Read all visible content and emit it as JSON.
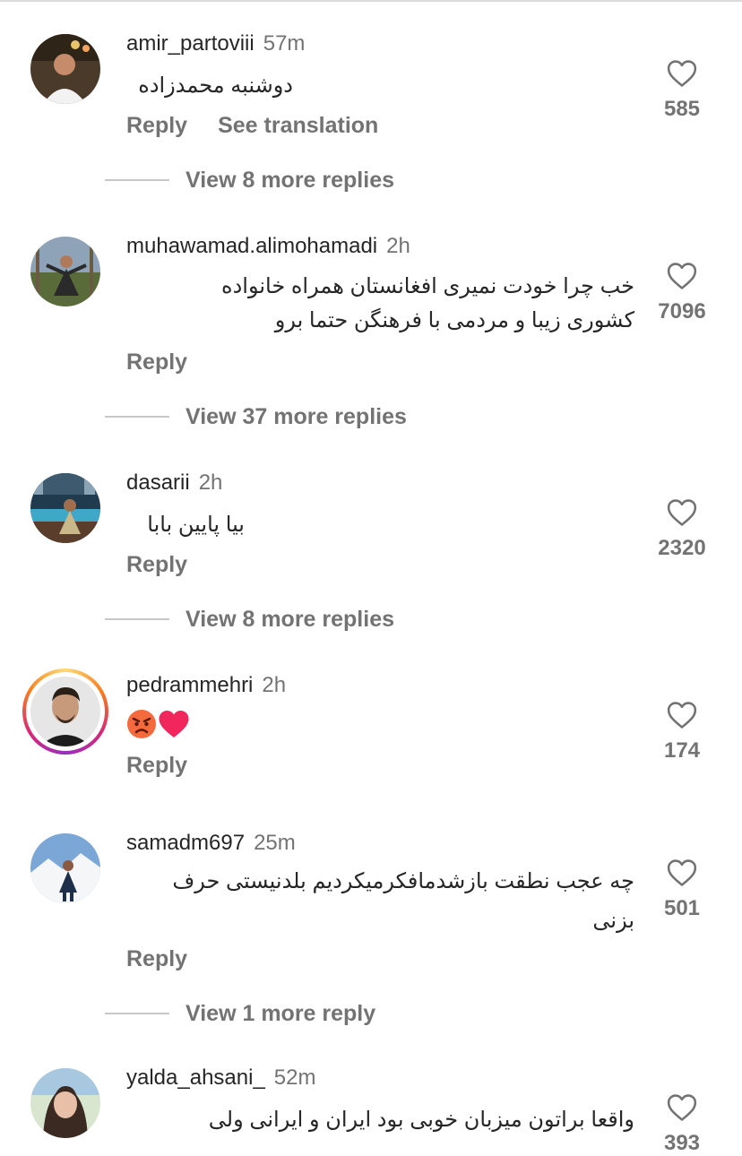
{
  "comments": [
    {
      "username": "amir_partoviii",
      "time": "57m",
      "text": "دوشنبه محمدزاده",
      "actions": [
        "Reply",
        "See translation"
      ],
      "likes": "585",
      "view_more": "View 8 more replies"
    },
    {
      "username": "muhawamad.alimohamadi",
      "time": "2h",
      "text_lines": [
        "خب چرا خودت نمیری افغانستان همراه خانواده",
        "کشوری زیبا و مردمی با فرهنگن حتما برو"
      ],
      "actions": [
        "Reply"
      ],
      "likes": "7096",
      "view_more": "View 37 more replies"
    },
    {
      "username": "dasarii",
      "time": "2h",
      "text": "بیا پایین بابا",
      "actions": [
        "Reply"
      ],
      "likes": "2320",
      "view_more": "View 8 more replies"
    },
    {
      "username": "pedrammehri",
      "time": "2h",
      "emojis": [
        "angry-face-emoji",
        "heart-emoji"
      ],
      "actions": [
        "Reply"
      ],
      "likes": "174"
    },
    {
      "username": "samadm697",
      "time": "25m",
      "text_lines": [
        "چه عجب نطقت بازشدمافکرمیکردیم بلدنیستی حرف",
        "بزنی"
      ],
      "actions": [
        "Reply"
      ],
      "likes": "501",
      "view_more": "View 1 more reply"
    },
    {
      "username": "yalda_ahsani_",
      "time": "52m",
      "text_lines": [
        "واقعا براتون میزبان خوبی بود ایران و ایرانی ولی"
      ],
      "likes": "393"
    }
  ],
  "colors": {
    "text": "#262626",
    "secondary": "#737373",
    "divider": "#c7c7c7"
  }
}
